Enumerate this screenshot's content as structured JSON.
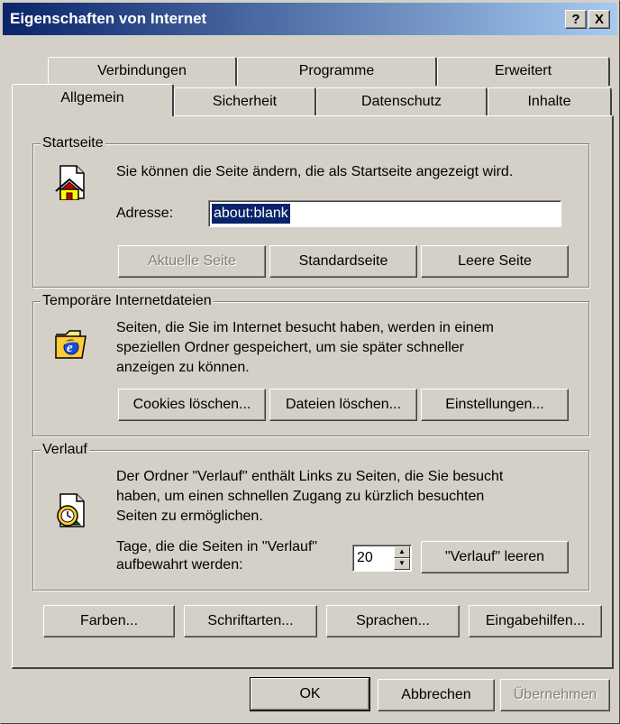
{
  "window": {
    "title": "Eigenschaften von Internet",
    "help_label": "?",
    "close_label": "X"
  },
  "tabs_back": [
    "Verbindungen",
    "Programme",
    "Erweitert"
  ],
  "tabs_front": [
    "Allgemein",
    "Sicherheit",
    "Datenschutz",
    "Inhalte"
  ],
  "startseite": {
    "legend": "Startseite",
    "description": "Sie können die Seite ändern, die als Startseite angezeigt wird.",
    "address_label": "Adresse:",
    "address_value": "about:blank",
    "btn_current": "Aktuelle Seite",
    "btn_default": "Standardseite",
    "btn_empty": "Leere Seite"
  },
  "temp_files": {
    "legend": "Temporäre Internetdateien",
    "description_1": "Seiten, die Sie im Internet besucht haben, werden in einem",
    "description_2": "speziellen Ordner gespeichert, um sie später schneller",
    "description_3": "anzeigen zu können.",
    "btn_cookies": "Cookies löschen...",
    "btn_files": "Dateien löschen...",
    "btn_settings": "Einstellungen..."
  },
  "history": {
    "legend": "Verlauf",
    "description_1": "Der Ordner \"Verlauf\" enthält Links zu Seiten, die Sie besucht",
    "description_2": "haben, um einen schnellen Zugang zu kürzlich besuchten",
    "description_3": "Seiten zu ermöglichen.",
    "days_label_1": "Tage, die die Seiten in \"Verlauf\"",
    "days_label_2": "aufbewahrt werden:",
    "days_value": "20",
    "btn_clear": "\"Verlauf\" leeren"
  },
  "bottom_buttons": {
    "colors": "Farben...",
    "fonts": "Schriftarten...",
    "languages": "Sprachen...",
    "accessibility": "Eingabehilfen..."
  },
  "dialog_buttons": {
    "ok": "OK",
    "cancel": "Abbrechen",
    "apply": "Übernehmen"
  },
  "icons": {
    "home": "home-page-icon",
    "temp": "ie-folder-icon",
    "history": "history-clock-icon"
  }
}
